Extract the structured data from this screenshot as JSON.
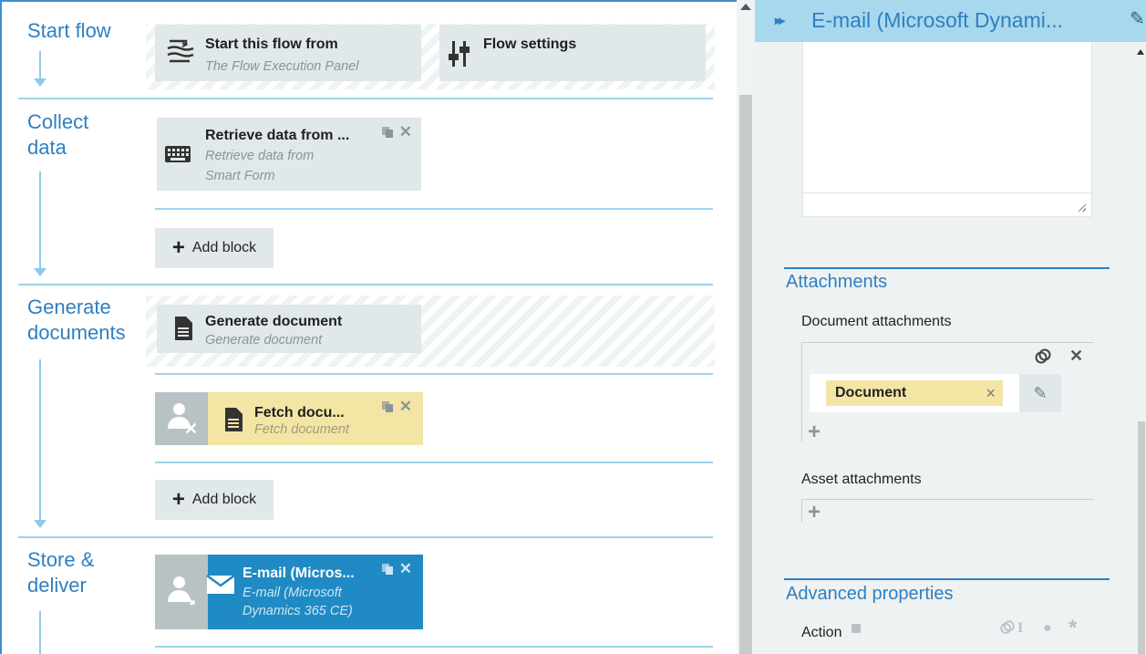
{
  "flow": {
    "stages": {
      "start": {
        "title": "Start flow"
      },
      "collect": {
        "title_line1": "Collect",
        "title_line2": "data"
      },
      "generate": {
        "title_line1": "Generate",
        "title_line2": "documents"
      },
      "store": {
        "title_line1": "Store &",
        "title_line2": "deliver"
      }
    },
    "start_block": {
      "title": "Start this flow from",
      "desc": "The Flow Execution Panel"
    },
    "settings_block": {
      "title": "Flow settings"
    },
    "retrieve_block": {
      "title": "Retrieve data from ...",
      "desc_line1": "Retrieve data from",
      "desc_line2": "Smart Form"
    },
    "add_block_label": "Add block",
    "generate_block": {
      "title": "Generate document",
      "desc": "Generate document"
    },
    "fetch_block": {
      "title": "Fetch docu...",
      "desc": "Fetch document"
    },
    "email_block": {
      "title": "E-mail (Micros...",
      "desc_line1": "E-mail (Microsoft",
      "desc_line2": "Dynamics 365 CE)"
    },
    "colors": {
      "accent": "#2f7fc1",
      "connector": "#8ccbe6",
      "block_bg": "#e1e8e9",
      "fetch_bg": "#f3e5a4",
      "selected_bg": "#1f8ac3"
    }
  },
  "panel": {
    "header_title": "E-mail (Microsoft Dynami...",
    "attachments": {
      "section_title": "Attachments",
      "document_label": "Document attachments",
      "document_tag": "Document",
      "asset_label": "Asset attachments"
    },
    "advanced": {
      "section_title": "Advanced properties",
      "action_label": "Action"
    },
    "icons": [
      "expand-chevrons-icon",
      "pencil-icon",
      "link-icon",
      "close-icon",
      "plus-icon",
      "info-icon",
      "text-cursor-icon",
      "person-icon",
      "asterisk-icon"
    ]
  }
}
